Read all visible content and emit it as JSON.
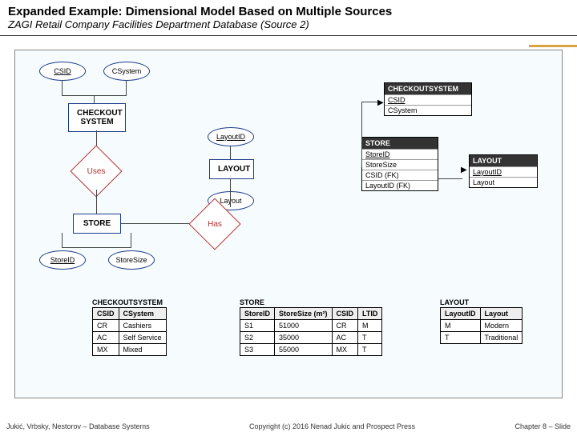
{
  "title": "Expanded Example: Dimensional Model Based on Multiple Sources",
  "subtitle": "ZAGI Retail Company Facilities Department Database (Source 2)",
  "footer": {
    "left": "Jukić, Vrbsky, Nestorov – Database Systems",
    "center": "Copyright (c) 2016 Nenad Jukic and Prospect Press",
    "right": "Chapter 8 – Slide"
  },
  "er": {
    "csid": "CSID",
    "csystem": "CSystem",
    "checkout": "CHECKOUT\nSYSTEM",
    "uses": "Uses",
    "store": "STORE",
    "storeid": "StoreID",
    "storesize": "StoreSize",
    "layoutid": "LayoutID",
    "layoutEnt": "LAYOUT",
    "layout": "Layout",
    "has": "Has"
  },
  "schema": {
    "checkout": {
      "name": "CHECKOUTSYSTEM",
      "cols": [
        "CSID",
        "CSystem"
      ]
    },
    "store": {
      "name": "STORE",
      "cols": [
        "StoreID",
        "StoreSize",
        "CSID (FK)",
        "LayoutID (FK)"
      ]
    },
    "layout": {
      "name": "LAYOUT",
      "cols": [
        "LayoutID",
        "Layout"
      ]
    }
  },
  "tables": {
    "checkout": {
      "name": "CHECKOUTSYSTEM",
      "headers": [
        "CSID",
        "CSystem"
      ],
      "rows": [
        [
          "CR",
          "Cashiers"
        ],
        [
          "AC",
          "Self Service"
        ],
        [
          "MX",
          "Mixed"
        ]
      ]
    },
    "store": {
      "name": "STORE",
      "headers": [
        "StoreID",
        "StoreSize (m²)",
        "CSID",
        "LTID"
      ],
      "rows": [
        [
          "S1",
          "51000",
          "CR",
          "M"
        ],
        [
          "S2",
          "35000",
          "AC",
          "T"
        ],
        [
          "S3",
          "55000",
          "MX",
          "T"
        ]
      ]
    },
    "layout": {
      "name": "LAYOUT",
      "headers": [
        "LayoutID",
        "Layout"
      ],
      "rows": [
        [
          "M",
          "Modern"
        ],
        [
          "T",
          "Traditional"
        ]
      ]
    }
  }
}
